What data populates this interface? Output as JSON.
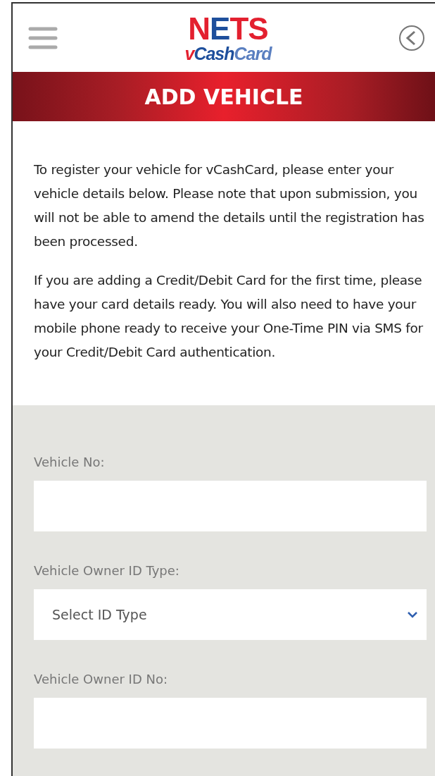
{
  "header": {
    "logo": {
      "top": [
        {
          "text": "N",
          "color": "#e3202f"
        },
        {
          "text": "E",
          "color": "#1e4f9c"
        },
        {
          "text": "TS",
          "color": "#e3202f"
        }
      ],
      "bottom": [
        {
          "text": "v",
          "color": "#e3202f"
        },
        {
          "text": "Cash",
          "color": "#1e4f9c"
        },
        {
          "text": "Card",
          "color": "#5a7fc0"
        }
      ]
    }
  },
  "banner": {
    "title": "ADD VEHICLE"
  },
  "intro": [
    "To register your vehicle for vCashCard, please enter your vehicle details below. Please note that upon submission, you will not be able to amend the details until the registration has been processed.",
    "If you are adding a Credit/Debit Card for the first time, please have your card details ready. You will also need to have your mobile phone ready to receive your One-Time PIN via SMS for your Credit/Debit Card authentication."
  ],
  "form": {
    "fields": [
      {
        "kind": "text",
        "label": "Vehicle No:"
      },
      {
        "kind": "select",
        "label": "Vehicle Owner ID Type:",
        "placeholder": "Select ID Type"
      },
      {
        "kind": "text",
        "label": "Vehicle Owner ID No:"
      }
    ]
  }
}
